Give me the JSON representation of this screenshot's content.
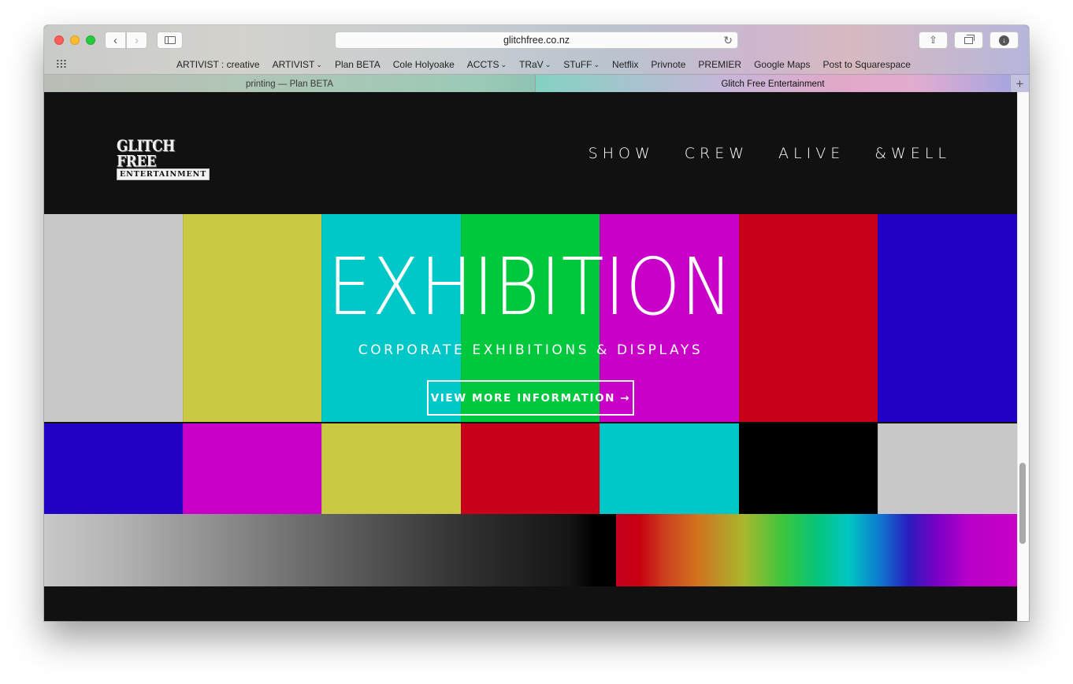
{
  "browser": {
    "url": "glitchfree.co.nz",
    "bookmarks": [
      {
        "label": "ARTIVIST : creative",
        "dropdown": false
      },
      {
        "label": "ARTIVIST",
        "dropdown": true
      },
      {
        "label": "Plan BETA",
        "dropdown": false
      },
      {
        "label": "Cole Holyoake",
        "dropdown": false
      },
      {
        "label": "ACCTS",
        "dropdown": true
      },
      {
        "label": "TRaV",
        "dropdown": true
      },
      {
        "label": "STuFF",
        "dropdown": true
      },
      {
        "label": "Netflix",
        "dropdown": false
      },
      {
        "label": "Privnote",
        "dropdown": false
      },
      {
        "label": "PREMIER",
        "dropdown": false
      },
      {
        "label": "Google Maps",
        "dropdown": false
      },
      {
        "label": "Post to Squarespace",
        "dropdown": false
      }
    ],
    "tabs": [
      {
        "title": "printing — Plan BETA",
        "active": false
      },
      {
        "title": "Glitch Free Entertainment",
        "active": true
      }
    ],
    "icons": {
      "back": "‹",
      "forward": "›",
      "reload": "↻",
      "new_tab": "+",
      "share": "⇧",
      "download": "↓",
      "chevron": "⌄"
    }
  },
  "site": {
    "logo": {
      "top": "GLITCH FREE",
      "bottom": "ENTERTAINMENT"
    },
    "nav": [
      "SHOW",
      "CREW",
      "ALIVE",
      "&WELL"
    ],
    "hero": {
      "title": "EXHIBITION",
      "subtitle": "CORPORATE EXHIBITIONS & DISPLAYS",
      "button_label": "VIEW MORE INFORMATION →"
    },
    "colors": {
      "test_bars_top": [
        "#c8c8c8",
        "#c9c944",
        "#00c8c8",
        "#00c83c",
        "#c800c8",
        "#c8001a",
        "#2200c4"
      ],
      "test_bars_middle": [
        "#2200c4",
        "#c800c8",
        "#c9c944",
        "#c8001a",
        "#00c8c8",
        "#000000",
        "#c8c8c8"
      ],
      "page_background": "#111111"
    }
  }
}
